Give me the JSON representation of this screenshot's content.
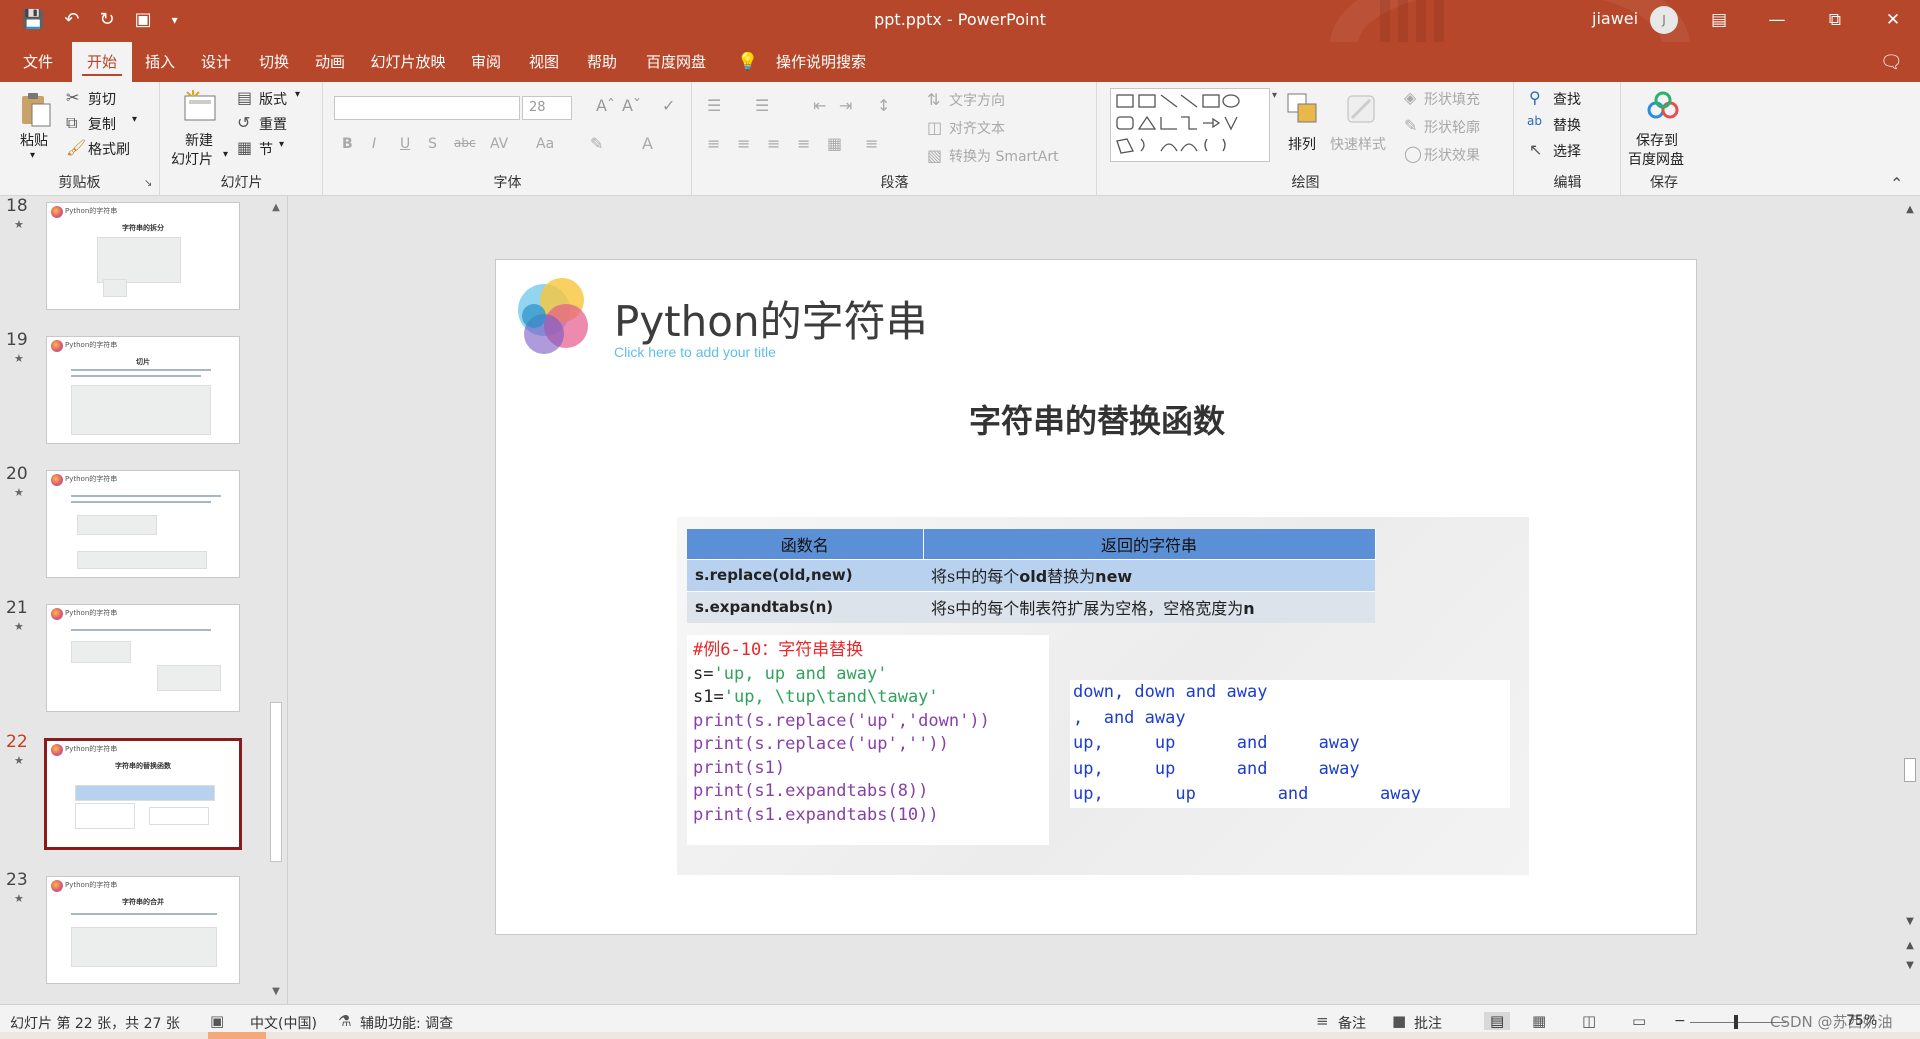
{
  "window": {
    "title": "ppt.pptx  -  PowerPoint",
    "user": "jiawei",
    "avatar_initial": "J"
  },
  "qat": {
    "save_icon": "save-icon",
    "undo_icon": "undo-icon",
    "redo_icon": "redo-icon",
    "present_icon": "present-from-start-icon"
  },
  "tabs": {
    "file": "文件",
    "home": "开始",
    "insert": "插入",
    "design": "设计",
    "transitions": "切换",
    "animations": "动画",
    "slideshow": "幻灯片放映",
    "review": "审阅",
    "view": "视图",
    "help": "帮助",
    "baidu": "百度网盘",
    "tellme": "操作说明搜索"
  },
  "ribbon": {
    "clipboard": {
      "paste": "粘贴",
      "cut": "剪切",
      "copy": "复制",
      "format_painter": "格式刷",
      "group": "剪贴板"
    },
    "slides": {
      "new_slide": "新建",
      "new_slide2": "幻灯片",
      "layout": "版式",
      "reset": "重置",
      "section": "节",
      "group": "幻灯片"
    },
    "font": {
      "font_name": "",
      "font_size": "28",
      "bold": "B",
      "italic": "I",
      "underline": "U",
      "shadow": "S",
      "strike": "abc",
      "spacing": "AV",
      "case": "Aa",
      "group": "字体"
    },
    "paragraph": {
      "text_direction": "文字方向",
      "align_text": "对齐文本",
      "smartart": "转换为 SmartArt",
      "group": "段落"
    },
    "drawing": {
      "arrange": "排列",
      "quick_styles": "快速样式",
      "shape_fill": "形状填充",
      "shape_outline": "形状轮廓",
      "shape_effects": "形状效果",
      "group": "绘图"
    },
    "editing": {
      "find": "查找",
      "replace": "替换",
      "select": "选择",
      "group": "编辑"
    },
    "save": {
      "save_to": "保存到",
      "save_to2": "百度网盘",
      "group": "保存"
    }
  },
  "thumbnails": [
    {
      "num": "18",
      "header": "Python的字符串",
      "title": "字符串的拆分"
    },
    {
      "num": "19",
      "header": "Python的字符串",
      "title": "切片"
    },
    {
      "num": "20",
      "header": "Python的字符串",
      "title": ""
    },
    {
      "num": "21",
      "header": "Python的字符串",
      "title": ""
    },
    {
      "num": "22",
      "header": "Python的字符串",
      "title": "字符串的替换函数"
    },
    {
      "num": "23",
      "header": "Python的字符串",
      "title": "字符串的合并"
    }
  ],
  "slide": {
    "title": "Python的字符串",
    "subtitle": "Click here to add your title",
    "heading": "字符串的替换函数",
    "table": {
      "headers": [
        "函数名",
        "返回的字符串"
      ],
      "rows": [
        {
          "func": "s.replace(old,new)",
          "desc_pre": "将s中的每个",
          "desc_bold": "old",
          "desc_mid": "替换为",
          "desc_post": "new"
        },
        {
          "func": "s.expandtabs(n)",
          "desc_pre": "将s中的每个制表符扩展为空格，空格宽度为",
          "desc_bold": "n",
          "desc_mid": "",
          "desc_post": ""
        }
      ]
    },
    "code": {
      "comment": "#例6-10：字符串替换",
      "line1_a": "s=",
      "line1_b": "'up, up and away'",
      "line2_a": "s1=",
      "line2_b": "'up, \\tup\\tand\\taway'",
      "line3": "print(s.replace('up','down'))",
      "line4": "print(s.replace('up',''))",
      "line5": "print(s1)",
      "line6": "print(s1.expandtabs(8))",
      "line7": "print(s1.expandtabs(10))"
    },
    "output": [
      "down, down and away",
      ",  and away",
      "up,     up      and     away",
      "up,     up      and     away",
      "up,       up        and       away"
    ]
  },
  "status": {
    "slide_info": "幻灯片 第 22 张，共 27 张",
    "language": "中文(中国)",
    "accessibility": "辅助功能: 调查",
    "notes": "备注",
    "comments": "批注",
    "zoom": "75%",
    "watermark": "CSDN @苏西奶油"
  },
  "colors": {
    "accent": "#b7472a",
    "table_header": "#5b8fd6",
    "code_output": "#1b3ccf",
    "code_comment": "#e8272b"
  }
}
